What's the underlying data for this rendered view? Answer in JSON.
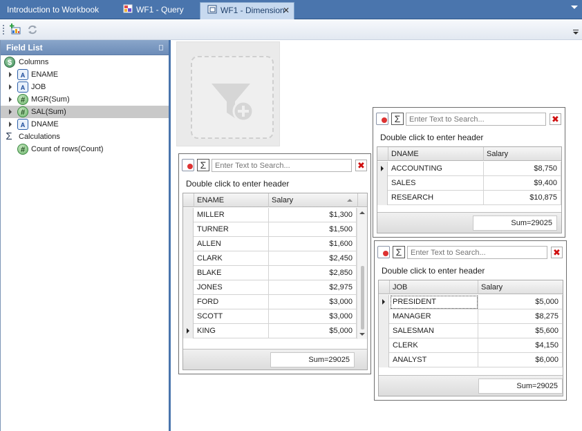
{
  "tabs": [
    {
      "label": "Introduction to Workbook",
      "icon": "",
      "active": false
    },
    {
      "label": "WF1 - Query",
      "icon": "query-icon",
      "active": false
    },
    {
      "label": "WF1 - Dimension",
      "icon": "dimension-icon",
      "active": true
    }
  ],
  "tab_close": "✕",
  "field_list": {
    "title": "Field List",
    "columns_label": "Columns",
    "columns": [
      {
        "label": "ENAME",
        "icon": "text-field-icon",
        "selected": false
      },
      {
        "label": "JOB",
        "icon": "text-field-icon",
        "selected": false
      },
      {
        "label": "MGR(Sum)",
        "icon": "number-field-icon",
        "selected": false
      },
      {
        "label": "SAL(Sum)",
        "icon": "number-field-icon",
        "selected": true
      },
      {
        "label": "DNAME",
        "icon": "text-field-icon",
        "selected": false
      }
    ],
    "calculations_label": "Calculations",
    "calculations": [
      {
        "label": "Count of rows(Count)",
        "icon": "number-field-icon"
      }
    ]
  },
  "widgets": {
    "ename": {
      "search_placeholder": "Enter Text to Search...",
      "header": "Double click to enter header",
      "columns": [
        "ENAME",
        "Salary"
      ],
      "rows": [
        [
          "MILLER",
          "$1,300"
        ],
        [
          "TURNER",
          "$1,500"
        ],
        [
          "ALLEN",
          "$1,600"
        ],
        [
          "CLARK",
          "$2,450"
        ],
        [
          "BLAKE",
          "$2,850"
        ],
        [
          "JONES",
          "$2,975"
        ],
        [
          "FORD",
          "$3,000"
        ],
        [
          "SCOTT",
          "$3,000"
        ],
        [
          "KING",
          "$5,000"
        ]
      ],
      "current_row": 8,
      "sum": "Sum=29025"
    },
    "dname": {
      "search_placeholder": "Enter Text to Search...",
      "header": "Double click to enter header",
      "columns": [
        "DNAME",
        "Salary"
      ],
      "rows": [
        [
          "ACCOUNTING",
          "$8,750"
        ],
        [
          "SALES",
          "$9,400"
        ],
        [
          "RESEARCH",
          "$10,875"
        ]
      ],
      "current_row": 0,
      "sum": "Sum=29025"
    },
    "job": {
      "search_placeholder": "Enter Text to Search...",
      "header": "Double click to enter header",
      "columns": [
        "JOB",
        "Salary"
      ],
      "rows": [
        [
          "PRESIDENT",
          "$5,000"
        ],
        [
          "MANAGER",
          "$8,275"
        ],
        [
          "SALESMAN",
          "$5,600"
        ],
        [
          "CLERK",
          "$4,150"
        ],
        [
          "ANALYST",
          "$6,000"
        ]
      ],
      "current_row": 0,
      "sum": "Sum=29025"
    }
  },
  "icons": {
    "sigma": "Σ",
    "close": "✖"
  }
}
